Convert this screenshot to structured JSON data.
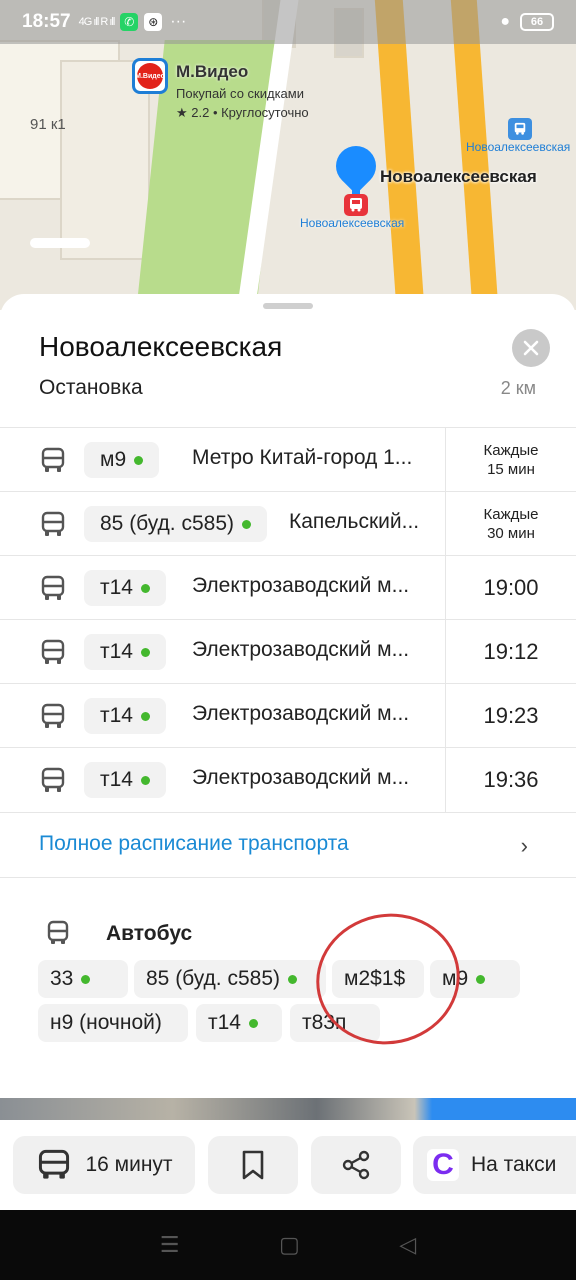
{
  "status_bar": {
    "time": "18:57",
    "signal": "4G ıll R ıll",
    "more": "···",
    "battery": "66"
  },
  "map": {
    "building_label": "91 к1",
    "poi": {
      "name": "М.Видео",
      "subtitle": "Покупай со скидками",
      "rating": "★ 2.2 • Круглосуточно",
      "logo_text": "М.Видео"
    },
    "stop_name": "Новоалексеевская",
    "stop_small": "Новоалексеевская",
    "stop2_name": "Новоалексеевская"
  },
  "card": {
    "title": "Новоалексеевская",
    "subtitle": "Остановка",
    "distance": "2 км"
  },
  "routes": [
    {
      "number": "м9",
      "destination": "Метро Китай-город 1...",
      "time_line1": "Каждые",
      "time_line2": "15 мин",
      "time": ""
    },
    {
      "number": "85 (буд. с585)",
      "destination": "Капельский...",
      "time_line1": "Каждые",
      "time_line2": "30 мин",
      "time": ""
    },
    {
      "number": "т14",
      "destination": "Электрозаводский м...",
      "time": "19:00"
    },
    {
      "number": "т14",
      "destination": "Электрозаводский м...",
      "time": "19:12"
    },
    {
      "number": "т14",
      "destination": "Электрозаводский м...",
      "time": "19:23"
    },
    {
      "number": "т14",
      "destination": "Электрозаводский м...",
      "time": "19:36"
    }
  ],
  "full_schedule": {
    "label": "Полное расписание транспорта",
    "chevron": "›"
  },
  "bus_section": {
    "label": "Автобус",
    "tags": [
      "33",
      "85 (буд. с585)",
      "м2$1$",
      "м9",
      "н9 (ночной)",
      "т14",
      "т83п"
    ]
  },
  "bottom_bar": {
    "route_label": "16 минут",
    "taxi_label": "На такси",
    "taxi_logo": "C"
  },
  "colors": {
    "accent": "#1a8ad4",
    "pin": "#1a8cff",
    "stop_red": "#e8333a",
    "live_dot": "#44b82e",
    "annotation": "#d23a3a"
  }
}
